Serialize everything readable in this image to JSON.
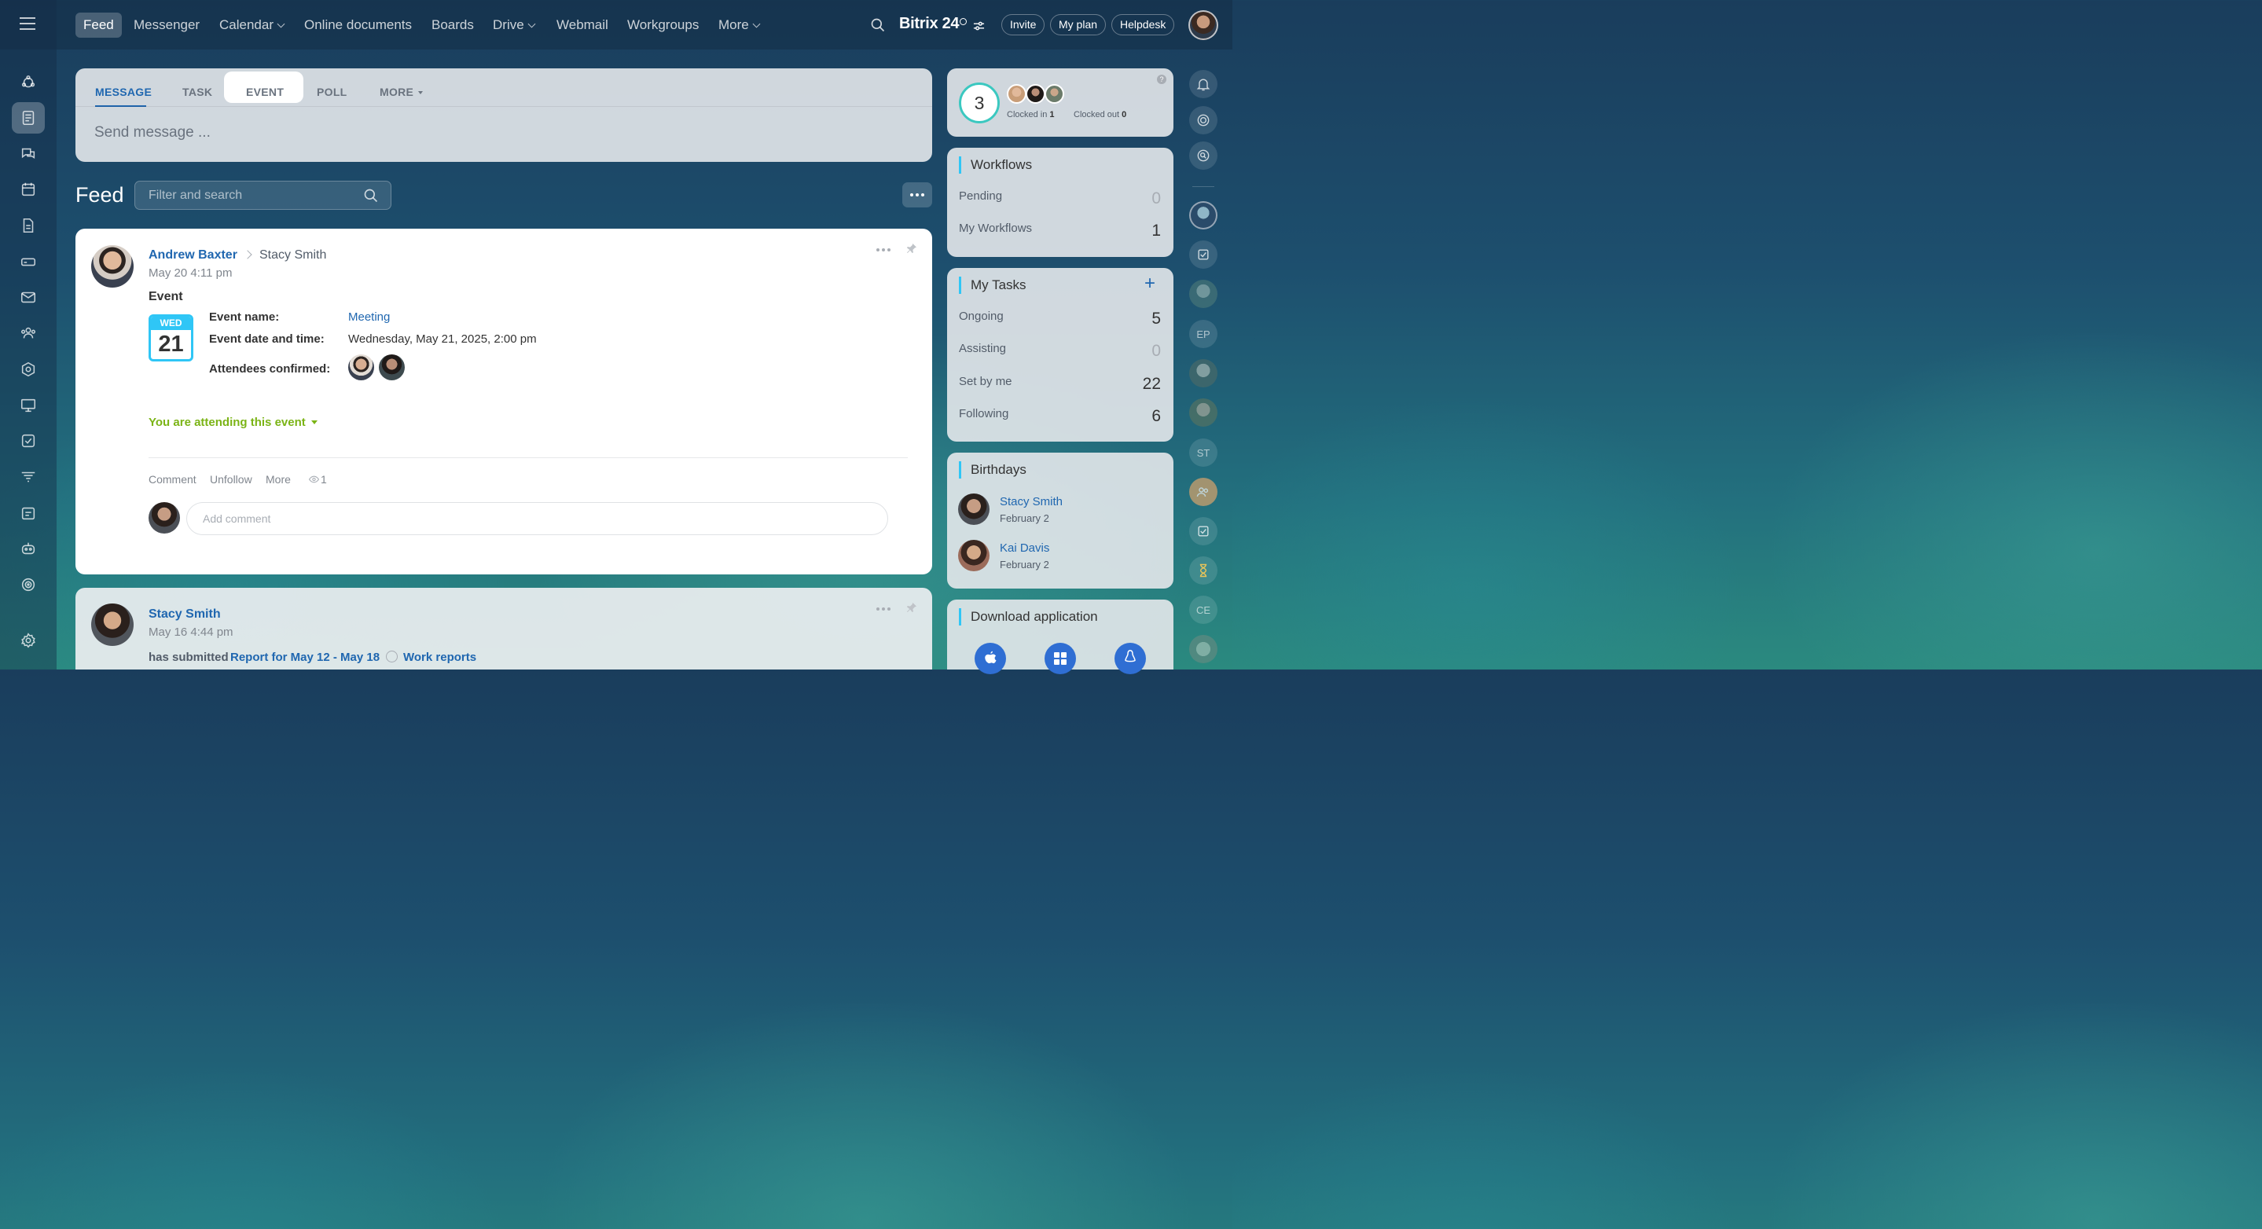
{
  "topbar": {
    "nav": [
      {
        "label": "Feed",
        "active": true
      },
      {
        "label": "Messenger"
      },
      {
        "label": "Calendar",
        "chevron": true
      },
      {
        "label": "Online documents"
      },
      {
        "label": "Boards"
      },
      {
        "label": "Drive",
        "chevron": true
      },
      {
        "label": "Webmail"
      },
      {
        "label": "Workgroups"
      },
      {
        "label": "More",
        "chevron": true
      }
    ],
    "brand": "Bitrix 24",
    "buttons": {
      "invite": "Invite",
      "plan": "My plan",
      "helpdesk": "Helpdesk"
    }
  },
  "composer": {
    "tabs": [
      "MESSAGE",
      "TASK",
      "EVENT",
      "POLL",
      "MORE"
    ],
    "placeholder": "Send message ..."
  },
  "feed": {
    "title": "Feed",
    "filter_placeholder": "Filter and search"
  },
  "post1": {
    "author": "Andrew Baxter",
    "recipient": "Stacy Smith",
    "time": "May 20 4:11 pm",
    "type": "Event",
    "calendar": {
      "day": "WED",
      "date": "21"
    },
    "fields": {
      "name_label": "Event name:",
      "name_value": "Meeting",
      "date_label": "Event date and time:",
      "date_value": "Wednesday, May 21, 2025, 2:00 pm",
      "attendees_label": "Attendees confirmed:"
    },
    "attending": "You are attending this event",
    "actions": {
      "comment": "Comment",
      "unfollow": "Unfollow",
      "more": "More",
      "views": "1"
    },
    "comment_placeholder": "Add comment"
  },
  "post2": {
    "author": "Stacy Smith",
    "time": "May 16 4:44 pm",
    "text_prefix": "has submitted",
    "report": "Report for May 12 - May 18",
    "section": "Work reports"
  },
  "timeman": {
    "count": "3",
    "clocked_in_label": "Clocked in",
    "clocked_in": "1",
    "clocked_out_label": "Clocked out",
    "clocked_out": "0"
  },
  "workflows": {
    "title": "Workflows",
    "rows": [
      {
        "label": "Pending",
        "value": "0"
      },
      {
        "label": "My Workflows",
        "value": "1"
      }
    ]
  },
  "tasks": {
    "title": "My Tasks",
    "rows": [
      {
        "label": "Ongoing",
        "value": "5"
      },
      {
        "label": "Assisting",
        "value": "0"
      },
      {
        "label": "Set by me",
        "value": "22"
      },
      {
        "label": "Following",
        "value": "6"
      }
    ]
  },
  "birthdays": {
    "title": "Birthdays",
    "people": [
      {
        "name": "Stacy Smith",
        "date": "February 2"
      },
      {
        "name": "Kai Davis",
        "date": "February 2"
      }
    ]
  },
  "download": {
    "title": "Download application"
  },
  "right_rail": {
    "ep": "EP",
    "st": "ST",
    "ce": "CE"
  },
  "colors": {
    "accent": "#2fc6f6",
    "link": "#2067b0",
    "green": "#7bb416"
  }
}
